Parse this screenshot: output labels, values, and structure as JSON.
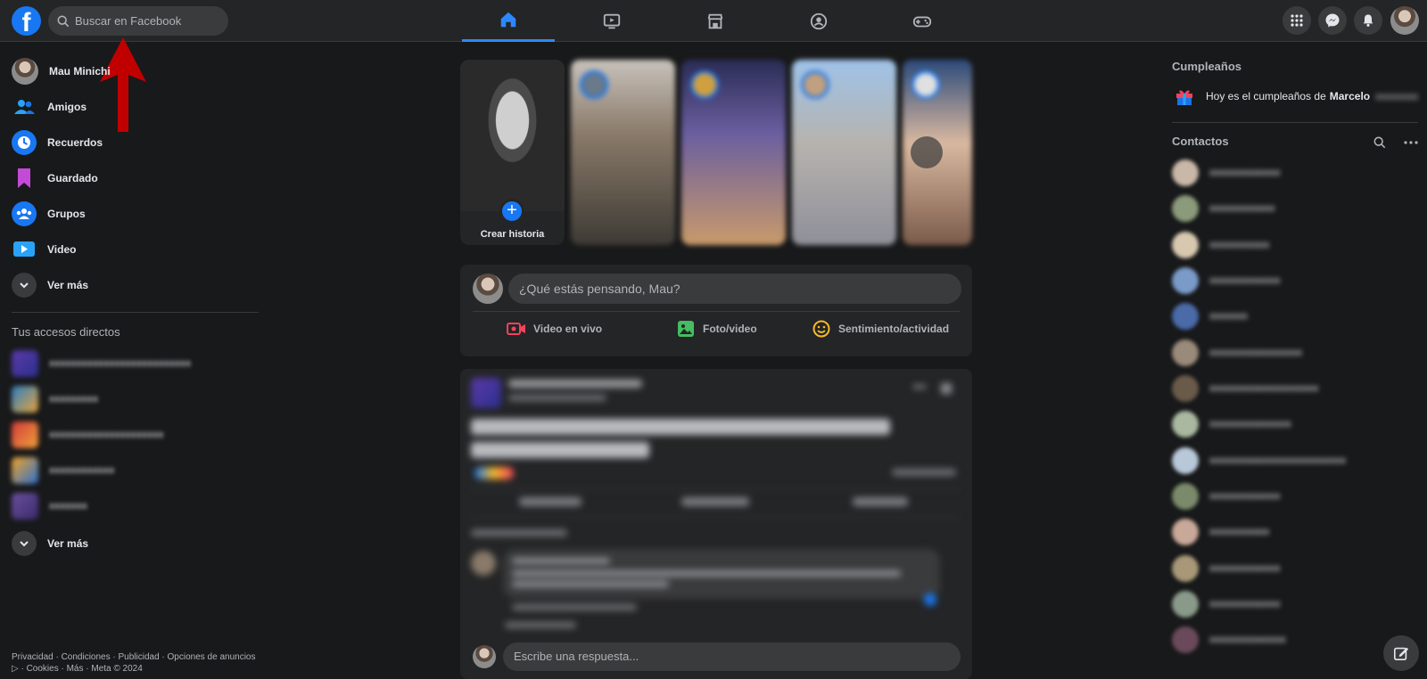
{
  "top": {
    "logo": "f",
    "search_placeholder": "Buscar en Facebook",
    "nav_tabs": [
      "home-icon",
      "watch-icon",
      "marketplace-icon",
      "groups-icon",
      "gaming-icon"
    ],
    "right_buttons": [
      "menu-grid-icon",
      "messenger-icon",
      "bell-icon",
      "profile-avatar"
    ]
  },
  "sidebar": {
    "user_name": "Mau Minichi",
    "items": [
      {
        "label": "Amigos",
        "icon": "friends-icon"
      },
      {
        "label": "Recuerdos",
        "icon": "memories-icon"
      },
      {
        "label": "Guardado",
        "icon": "saved-icon"
      },
      {
        "label": "Grupos",
        "icon": "groups-icon"
      },
      {
        "label": "Video",
        "icon": "video-icon"
      }
    ],
    "see_more": "Ver más",
    "shortcuts_title": "Tus accesos directos",
    "shortcuts_see_more": "Ver más",
    "footer_line1": "Privacidad · Condiciones · Publicidad · Opciones de anuncios",
    "footer_line2": "▷ · Cookies · Más · Meta © 2024"
  },
  "stories": {
    "create_label": "Crear historia",
    "plus": "+"
  },
  "composer": {
    "placeholder": "¿Qué estás pensando, Mau?",
    "actions": [
      {
        "label": "Video en vivo",
        "icon": "live-video-icon",
        "color": "#f3425f"
      },
      {
        "label": "Foto/video",
        "icon": "photo-icon",
        "color": "#45bd62"
      },
      {
        "label": "Sentimiento/actividad",
        "icon": "feeling-icon",
        "color": "#f7b928"
      }
    ]
  },
  "post": {
    "reply_placeholder": "Escribe una respuesta..."
  },
  "right": {
    "birthdays_title": "Cumpleaños",
    "birthday_text": "Hoy es el cumpleaños de ",
    "birthday_name": "Marcelo",
    "contacts_title": "Contactos"
  },
  "colors": {
    "accent": "#1877f2",
    "background": "#18191a",
    "surface": "#242526"
  }
}
